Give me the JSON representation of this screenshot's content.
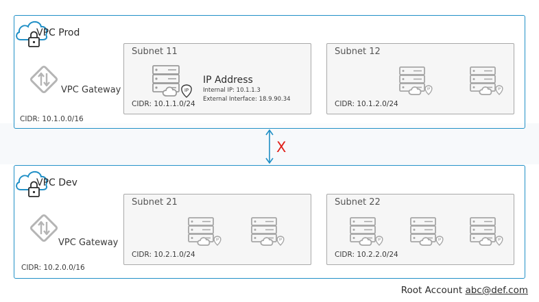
{
  "vpcs": {
    "prod": {
      "name": "VPC Prod",
      "gateway_label": "VPC Gateway",
      "cidr": "CIDR: 10.1.0.0/16",
      "subnets": [
        {
          "name": "Subnet 11",
          "cidr": "CIDR: 10.1.1.0/24",
          "ip_info": {
            "title": "IP Address",
            "internal": "Internal IP: 10.1.1.3",
            "external": "External Interface: 18.9.90.34"
          }
        },
        {
          "name": "Subnet 12",
          "cidr": "CIDR: 10.1.2.0/24"
        }
      ]
    },
    "dev": {
      "name": "VPC Dev",
      "gateway_label": "VPC Gateway",
      "cidr": "CIDR: 10.2.0.0/16",
      "subnets": [
        {
          "name": "Subnet 21",
          "cidr": "CIDR: 10.2.1.0/24"
        },
        {
          "name": "Subnet 22",
          "cidr": "CIDR: 10.2.2.0/24"
        }
      ]
    }
  },
  "connection": {
    "mark": "X",
    "mark_color": "#e0201a",
    "arrow_color": "#1f8fc6"
  },
  "footer": {
    "label": "Root Account",
    "email": "abc@def.com"
  },
  "icons": {
    "vpc": "cloud-lock-icon",
    "gateway": "vpc-gateway-icon",
    "server": "server-cloud-ip-icon"
  },
  "colors": {
    "vpc_border": "#1f8fc6",
    "subnet_border": "#a8a8a8",
    "subnet_bg": "#f6f6f6"
  }
}
